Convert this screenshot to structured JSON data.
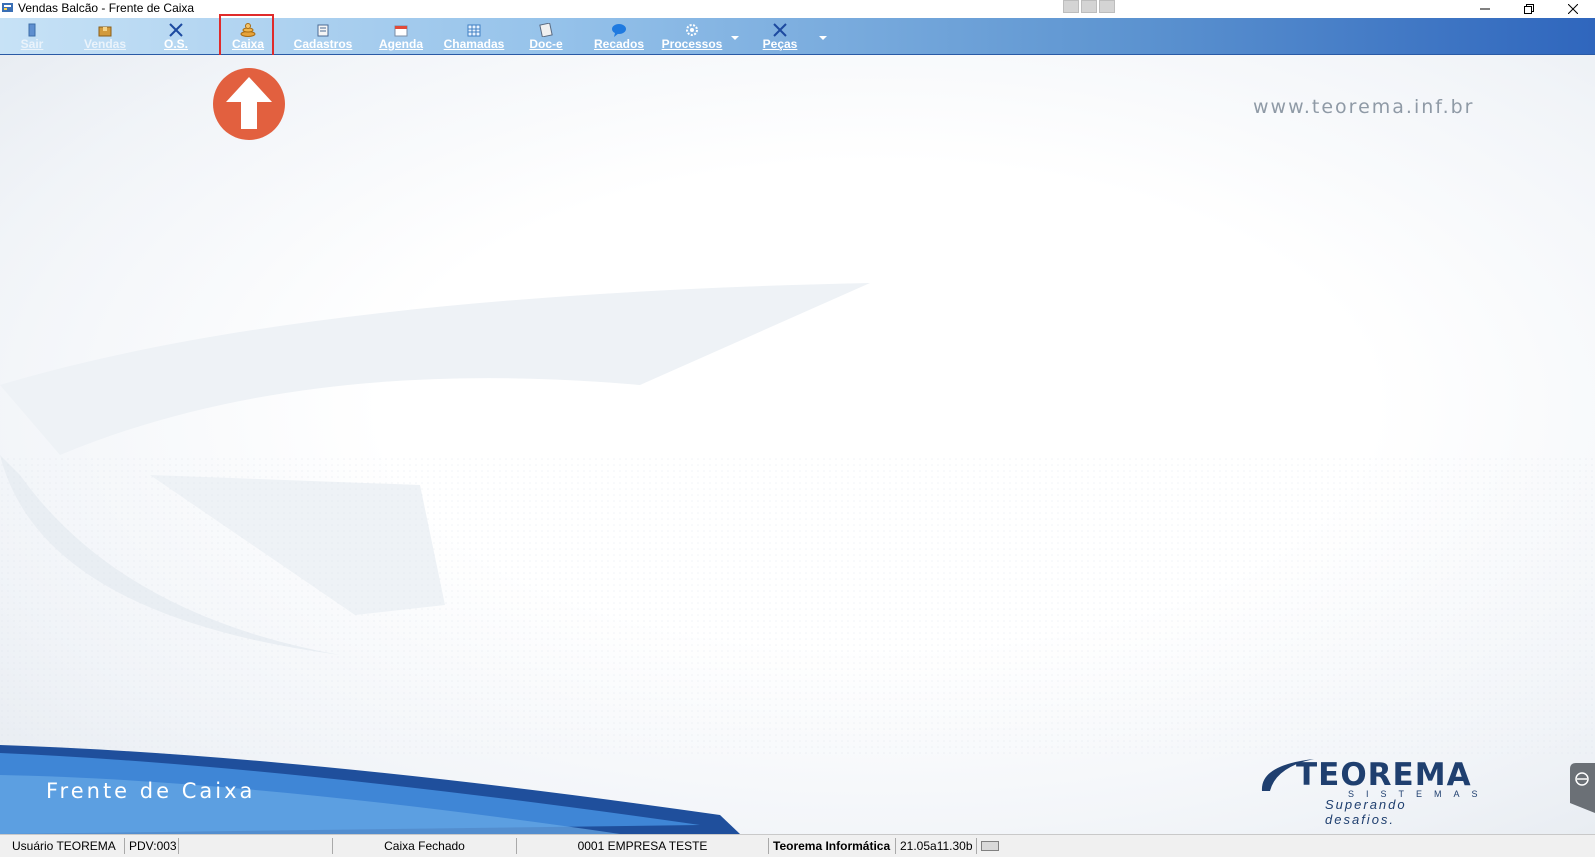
{
  "window": {
    "title": "Vendas Balcão - Frente de Caixa"
  },
  "toolbar": {
    "items": [
      {
        "label": "Sair"
      },
      {
        "label": "Vendas"
      },
      {
        "label": "O.S."
      },
      {
        "label": "Caixa"
      },
      {
        "label": "Cadastros"
      },
      {
        "label": "Agenda"
      },
      {
        "label": "Chamadas"
      },
      {
        "label": "Doc-e"
      },
      {
        "label": "Recados"
      },
      {
        "label": "Processos"
      },
      {
        "label": "Peças"
      }
    ],
    "highlighted_item": "Caixa"
  },
  "main": {
    "url_text": "www.teorema.inf.br",
    "banner_text": "Frente de Caixa",
    "logo": {
      "name": "TEOREMA",
      "subtitle": "SISTEMAS",
      "tagline": "Superando desafios."
    }
  },
  "statusbar": {
    "user": "Usuário TEOREMA",
    "pdv": "PDV:003",
    "empty": "",
    "caixa_status": "Caixa Fechado",
    "empresa": "0001 EMPRESA TESTE",
    "vendor": "Teorema Informática",
    "version": "21.05a11.30b"
  },
  "colors": {
    "toolbar_start": "#c7e2f6",
    "toolbar_end": "#2f66bd",
    "highlight": "#e02b2b",
    "arrow_circle": "#e2603f",
    "brand_blue": "#1f3f6f"
  },
  "icons": {
    "sair": "door-icon",
    "vendas": "box-icon",
    "os": "tools-icon",
    "caixa": "coins-icon",
    "cadastros": "form-icon",
    "agenda": "calendar-icon",
    "chamadas": "grid-icon",
    "doce": "document-icon",
    "recados": "chat-bubble-icon",
    "processos": "gear-icon",
    "pecas": "wrench-icon"
  }
}
